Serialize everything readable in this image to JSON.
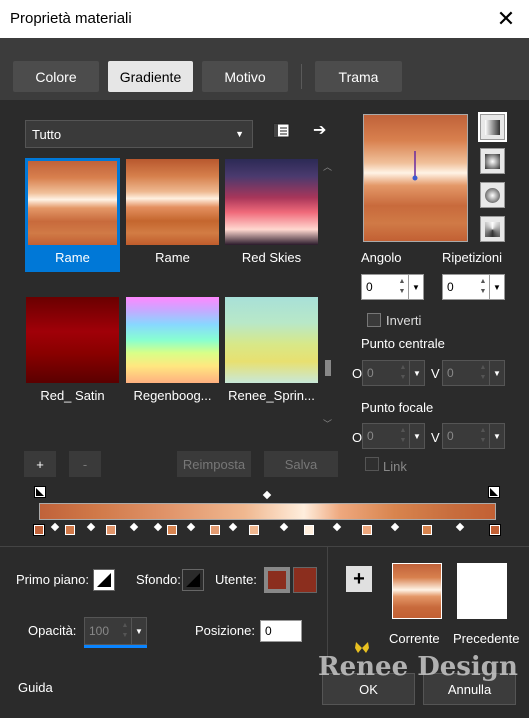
{
  "window": {
    "title": "Proprietà materiali",
    "close_icon": "close-icon"
  },
  "tabs": [
    {
      "label": "Colore",
      "active": false
    },
    {
      "label": "Gradiente",
      "active": true
    },
    {
      "label": "Motivo",
      "active": false
    },
    {
      "label": "Trama",
      "active": false
    }
  ],
  "library": {
    "category": "Tutto",
    "items": [
      {
        "label": "Rame",
        "selected": true
      },
      {
        "label": "Rame",
        "selected": false
      },
      {
        "label": "Red Skies",
        "selected": false
      },
      {
        "label": "Red_ Satin",
        "selected": false
      },
      {
        "label": "Regenboog...",
        "selected": false
      },
      {
        "label": "Renee_Sprin...",
        "selected": false
      }
    ],
    "add_label": "+",
    "remove_label": "-",
    "reset_label": "Reimposta",
    "save_label": "Salva"
  },
  "settings": {
    "angle_label": "Angolo",
    "angle_value": "0",
    "repeats_label": "Ripetizioni",
    "repeats_value": "0",
    "invert_label": "Inverti",
    "center_label": "Punto centrale",
    "center_o_label": "O",
    "center_o_value": "0",
    "center_v_label": "V",
    "center_v_value": "0",
    "focal_label": "Punto focale",
    "focal_o_label": "O",
    "focal_o_value": "0",
    "focal_v_label": "V",
    "focal_v_value": "0",
    "link_label": "Link"
  },
  "editor": {
    "foreground_label": "Primo piano:",
    "background_label": "Sfondo:",
    "user_label": "Utente:",
    "user_color": "#8b2e1e",
    "opacity_label": "Opacità:",
    "opacity_value": "100",
    "position_label": "Posizione:",
    "position_value": "0"
  },
  "current": {
    "add_label": "+",
    "current_label": "Corrente",
    "previous_label": "Precedente"
  },
  "watermark": "Renee Design",
  "footer": {
    "help_label": "Guida",
    "ok_label": "OK",
    "cancel_label": "Annulla"
  }
}
